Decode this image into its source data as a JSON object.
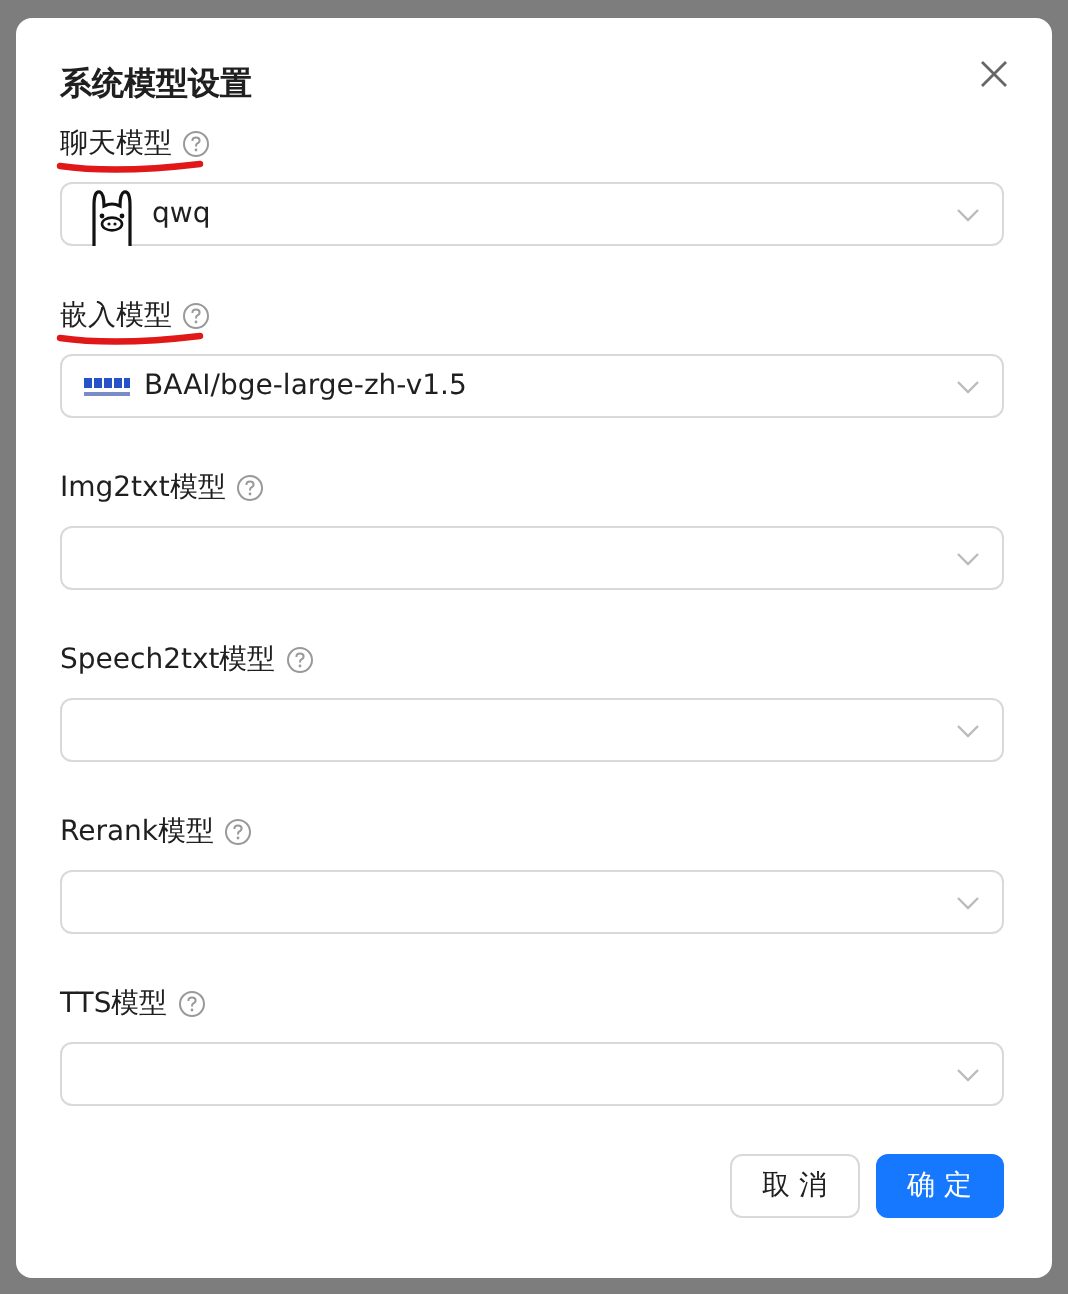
{
  "dialog": {
    "title": "系统模型设置"
  },
  "fields": [
    {
      "label": "聊天模型",
      "value": "qwq",
      "kind": "llama",
      "underlined": true
    },
    {
      "label": "嵌入模型",
      "value": "BAAI/bge-large-zh-v1.5",
      "kind": "baai",
      "underlined": true
    },
    {
      "label": "Img2txt模型",
      "kind": "empty",
      "underlined": false
    },
    {
      "label": "Speech2txt模型",
      "kind": "empty",
      "underlined": false
    },
    {
      "label": "Rerank模型",
      "kind": "empty",
      "underlined": false
    },
    {
      "label": "TTS模型",
      "kind": "empty",
      "underlined": false
    }
  ],
  "buttons": [
    {
      "label": "取 消",
      "kind": "default"
    },
    {
      "label": "确 定",
      "kind": "primary"
    }
  ]
}
